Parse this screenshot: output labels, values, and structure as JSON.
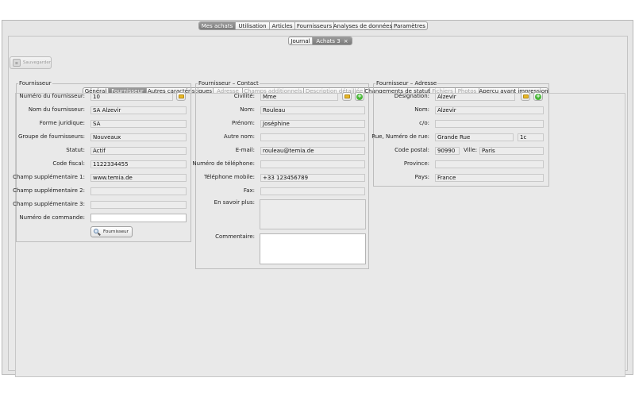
{
  "top_tabs": [
    {
      "label": "Mes achats",
      "active": true
    },
    {
      "label": "Utilisation",
      "active": false
    },
    {
      "label": "Articles",
      "active": false
    },
    {
      "label": "Fournisseurs",
      "active": false
    },
    {
      "label": "Analyses de données",
      "active": false
    },
    {
      "label": "Paramètres",
      "active": false
    }
  ],
  "doc_tabs": {
    "journal": "Journal",
    "achats": "Achats 3",
    "close": "×"
  },
  "toolbar": {
    "save_label": "Sauvegarder",
    "save_icon": "floppy-icon"
  },
  "section_tabs": [
    {
      "label": "Général",
      "state": "normal"
    },
    {
      "label": "Fournisseur",
      "state": "active"
    },
    {
      "label": "Autres caractéristiques",
      "state": "normal"
    },
    {
      "label": "Adresse",
      "state": "disabled"
    },
    {
      "label": "Champs additionnels",
      "state": "disabled"
    },
    {
      "label": "Description détaillée",
      "state": "disabled"
    },
    {
      "label": "Changements de statut",
      "state": "normal"
    },
    {
      "label": "Fichiers",
      "state": "disabled"
    },
    {
      "label": "Photos",
      "state": "disabled"
    },
    {
      "label": "Aperçu avant impression",
      "state": "normal"
    }
  ],
  "fournisseur": {
    "legend": "Fournisseur",
    "rows": [
      {
        "label": "Numéro du fournisseur:",
        "value": "10"
      },
      {
        "label": "Nom du fournisseur:",
        "value": "SA Alzevir"
      },
      {
        "label": "Forme juridique:",
        "value": "SA"
      },
      {
        "label": "Groupe de fournisseurs:",
        "value": "Nouveaux"
      },
      {
        "label": "Statut:",
        "value": "Actif"
      },
      {
        "label": "Code fiscal:",
        "value": "1122334455"
      },
      {
        "label": "Champ supplémentaire 1:",
        "value": "www.temia.de"
      },
      {
        "label": "Champ supplémentaire 2:",
        "value": ""
      },
      {
        "label": "Champ supplémentaire 3:",
        "value": ""
      },
      {
        "label": "Numéro de commande:",
        "value": ""
      }
    ],
    "search_button": "Fournisseur"
  },
  "contact": {
    "legend": "Fournisseur – Contact",
    "rows": [
      {
        "label": "Civilité:",
        "value": "Mme"
      },
      {
        "label": "Nom:",
        "value": "Rouleau"
      },
      {
        "label": "Prénom:",
        "value": "Joséphine"
      },
      {
        "label": "Autre nom:",
        "value": ""
      },
      {
        "label": "E-mail:",
        "value": "rouleau@temia.de"
      },
      {
        "label": "Numéro de téléphone:",
        "value": ""
      },
      {
        "label": "Téléphone mobile:",
        "value": "+33 123456789"
      },
      {
        "label": "Fax:",
        "value": ""
      }
    ],
    "more_label": "En savoir plus:",
    "comment_label": "Commentaire:"
  },
  "adresse": {
    "legend": "Fournisseur – Adresse",
    "rows": [
      {
        "label": "Désignation:",
        "value": "Alzevir"
      },
      {
        "label": "Nom:",
        "value": "Alzevir"
      },
      {
        "label": "c/o:",
        "value": ""
      },
      {
        "label": "Rue, Numéro de rue:",
        "value": "Grande Rue",
        "value2": "1c"
      },
      {
        "label": "Code postal:",
        "value": "90990",
        "city_label": "Ville:",
        "city": "Paris"
      },
      {
        "label": "Province:",
        "value": ""
      },
      {
        "label": "Pays:",
        "value": "France"
      }
    ]
  }
}
